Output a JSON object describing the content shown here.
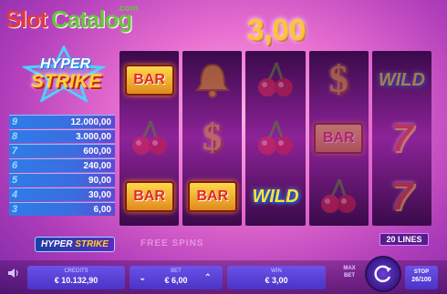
{
  "watermark": {
    "slot": "Slot",
    "catalog": "Catalog",
    "com": ".com"
  },
  "win_display": "3,00",
  "logo": {
    "hyper": "HYPER",
    "strike": "STRIKE"
  },
  "paytable": [
    {
      "count": "9",
      "value": "12.000,00"
    },
    {
      "count": "8",
      "value": "3.000,00"
    },
    {
      "count": "7",
      "value": "600,00"
    },
    {
      "count": "6",
      "value": "240,00"
    },
    {
      "count": "5",
      "value": "90,00"
    },
    {
      "count": "4",
      "value": "30,00"
    },
    {
      "count": "3",
      "value": "6,00"
    }
  ],
  "mini_logo": {
    "hyper": "HYPER",
    "strike": "STRIKE"
  },
  "reels": [
    [
      {
        "symbol": "bar",
        "label": "BAR",
        "active": true
      },
      {
        "symbol": "cherry",
        "active": false
      },
      {
        "symbol": "bar",
        "label": "BAR",
        "active": true
      }
    ],
    [
      {
        "symbol": "bell",
        "active": false
      },
      {
        "symbol": "dollar",
        "label": "$",
        "active": false
      },
      {
        "symbol": "bar",
        "label": "BAR",
        "active": true
      }
    ],
    [
      {
        "symbol": "cherry",
        "active": false
      },
      {
        "symbol": "cherry",
        "active": false
      },
      {
        "symbol": "wild",
        "label": "WILD",
        "active": true
      }
    ],
    [
      {
        "symbol": "dollar",
        "label": "$",
        "active": false
      },
      {
        "symbol": "bar",
        "label": "BAR",
        "active": false
      },
      {
        "symbol": "cherry",
        "active": false
      }
    ],
    [
      {
        "symbol": "wild",
        "label": "WILD",
        "active": false
      },
      {
        "symbol": "seven",
        "label": "7",
        "active": false
      },
      {
        "symbol": "seven",
        "label": "7",
        "active": false
      }
    ]
  ],
  "lines_badge": "20 LINES",
  "free_spins_text": "FREE SPINS",
  "bottom": {
    "credits_label": "CREDITS",
    "credits_value": "€ 10.132,90",
    "bet_label": "BET",
    "bet_value": "€ 6,00",
    "win_label": "WIN",
    "win_value": "€ 3,00",
    "maxbet_line1": "MAX",
    "maxbet_line2": "BET",
    "autoplay_label": "STOP",
    "autoplay_value": "26/100"
  },
  "colors": {
    "win_gold": "#ffc23a",
    "paytable_blue": "#2d7ce8",
    "panel_purple": "#5a40d8"
  },
  "icons": [
    "sound-icon",
    "spin-icon",
    "chevron-down-icon",
    "chevron-up-icon"
  ]
}
